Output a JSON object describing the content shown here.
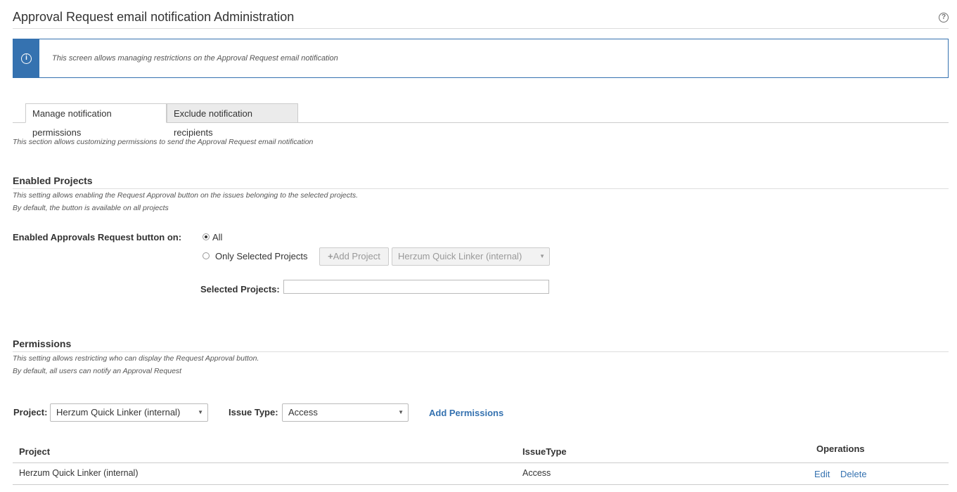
{
  "header": {
    "title": "Approval Request email notification Administration",
    "help_icon": "question-circle-icon"
  },
  "info_banner": {
    "icon": "info-circle-icon",
    "text": "This screen allows managing restrictions on the Approval Request email notification"
  },
  "tabs": [
    {
      "label": "Manage notification permissions",
      "active": true
    },
    {
      "label": "Exclude notification recipients",
      "active": false
    }
  ],
  "tab_description": "This section allows customizing permissions to send the Approval Request email notification",
  "enabled_projects": {
    "title": "Enabled Projects",
    "description_1": "This setting allows enabling the Request Approval button on the issues belonging to the selected projects.",
    "description_2": "By default, the button is available on all projects",
    "field_label": "Enabled Approvals Request button on:",
    "options": [
      {
        "label": "All",
        "checked": true
      },
      {
        "label": "Only Selected Projects",
        "checked": false
      }
    ],
    "add_project_label": "Add Project",
    "project_select_value": "Herzum Quick Linker (internal)",
    "selected_projects_label": "Selected Projects:",
    "selected_projects_value": ""
  },
  "permissions": {
    "title": "Permissions",
    "description_1": "This setting allows restricting who can display the Request Approval button.",
    "description_2": "By default, all users can notify an Approval Request",
    "project_label": "Project:",
    "project_value": "Herzum Quick Linker (internal)",
    "issue_type_label": "Issue Type:",
    "issue_type_value": "Access",
    "add_permissions_label": "Add Permissions",
    "table": {
      "headers": {
        "project": "Project",
        "issue_type": "IssueType",
        "operations": "Operations"
      },
      "rows": [
        {
          "project": "Herzum Quick Linker (internal)",
          "issue_type": "Access",
          "edit": "Edit",
          "delete": "Delete"
        }
      ]
    }
  },
  "colors": {
    "accent": "#3572b0",
    "tab_inactive_bg": "#ebebeb",
    "text": "#333333"
  }
}
